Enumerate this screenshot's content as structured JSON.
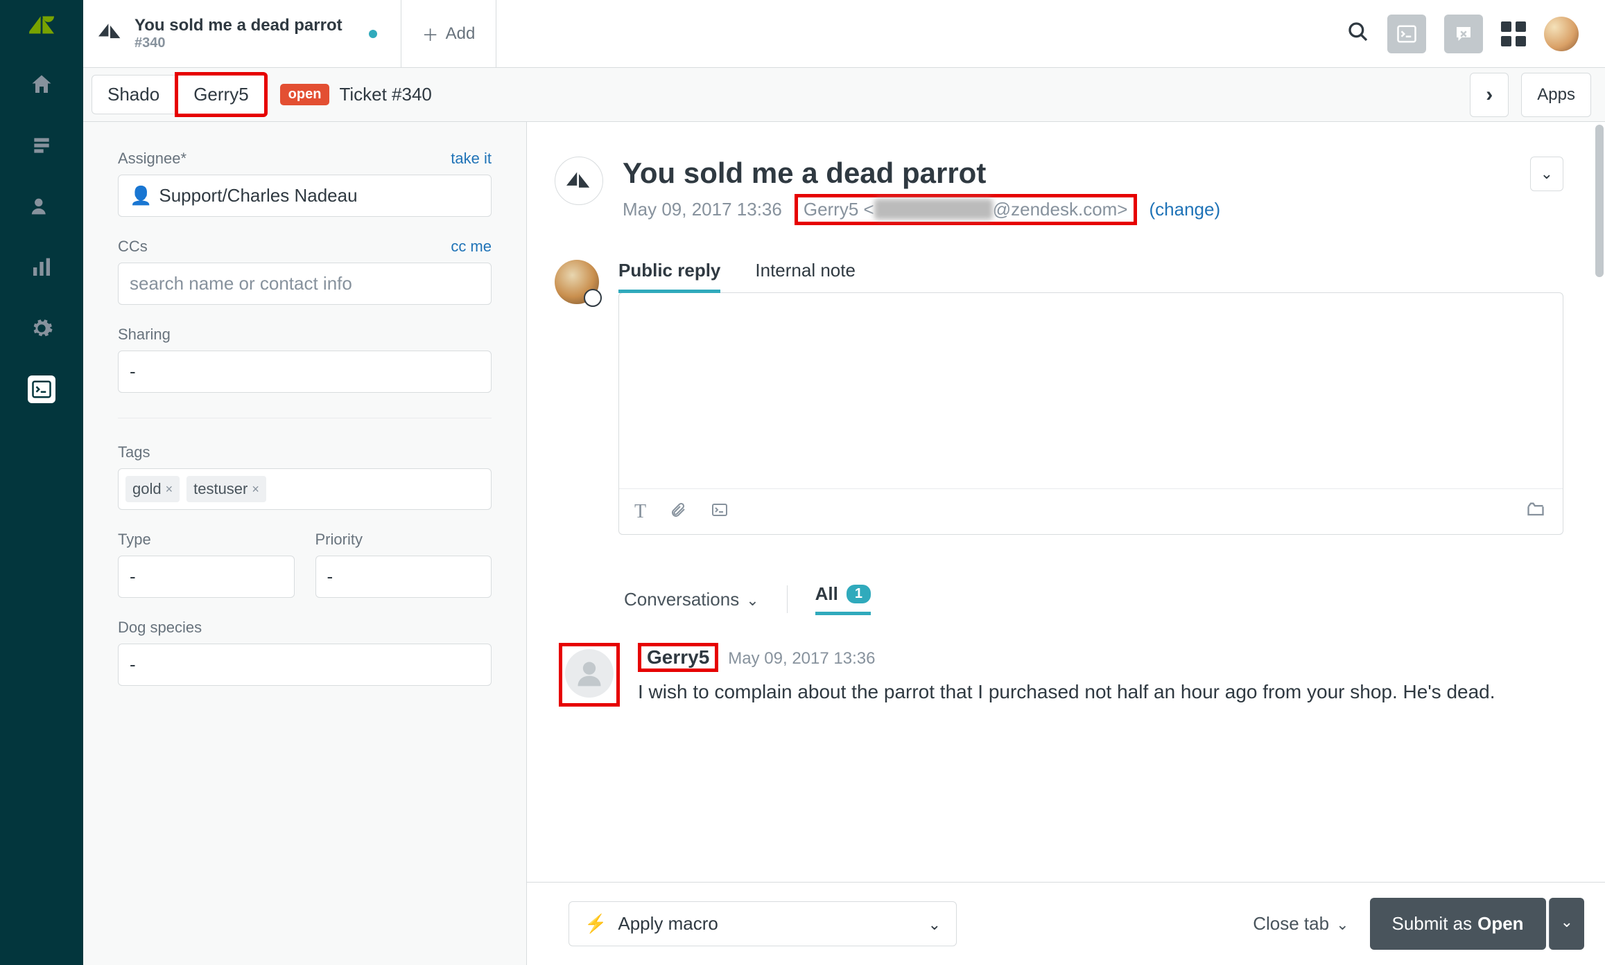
{
  "tab": {
    "title": "You sold me a dead parrot",
    "subtitle": "#340",
    "add_label": "Add"
  },
  "breadcrumb": {
    "org": "Shado",
    "requester": "Gerry5",
    "status": "open",
    "ticket_label": "Ticket #340",
    "apps_label": "Apps"
  },
  "sidebar": {
    "assignee_label": "Assignee*",
    "assignee_link": "take it",
    "assignee_value": "Support/Charles Nadeau",
    "ccs_label": "CCs",
    "ccs_link": "cc me",
    "ccs_placeholder": "search name or contact info",
    "sharing_label": "Sharing",
    "sharing_value": "-",
    "tags_label": "Tags",
    "tags": [
      "gold",
      "testuser"
    ],
    "type_label": "Type",
    "type_value": "-",
    "priority_label": "Priority",
    "priority_value": "-",
    "dog_label": "Dog species",
    "dog_value": "-"
  },
  "ticket": {
    "title": "You sold me a dead parrot",
    "date": "May 09, 2017 13:36",
    "requester_name": "Gerry5",
    "requester_email_domain": "@zendesk.com>",
    "change_label": "(change)"
  },
  "reply": {
    "tab_public": "Public reply",
    "tab_internal": "Internal note"
  },
  "conversations": {
    "label": "Conversations",
    "all_label": "All",
    "all_count": "1"
  },
  "message": {
    "author": "Gerry5",
    "date": "May 09, 2017 13:36",
    "text": "I wish to complain about the parrot that I purchased not half an hour ago from your shop. He's dead."
  },
  "footer": {
    "macro_label": "Apply macro",
    "close_label": "Close tab",
    "submit_prefix": "Submit as ",
    "submit_status": "Open"
  }
}
